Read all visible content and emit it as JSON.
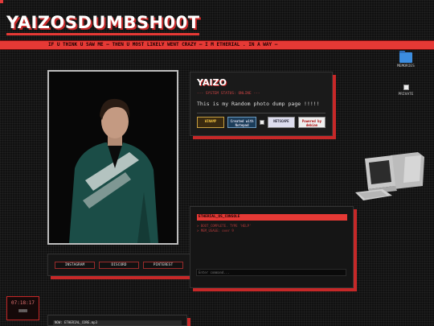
{
  "site": {
    "title": "YAIZOSDUMBSH00T",
    "marquee": "IF U THINK U SAW ME — THEN U MOST LIKELY WENT CRAZY — I M ETHERIAL . IN A WAY —"
  },
  "desktop": {
    "memories_label": "MEMORIES",
    "private_label": "PRIVATE"
  },
  "social": {
    "instagram": "INSTAGRAM",
    "discord": "DISCORD",
    "pinterest": "PINTEREST"
  },
  "card": {
    "title": "YAIZO",
    "status": "--- SYSTEM STATUS: ONLINE ---",
    "text": "This is my Random photo dump page !!!!!",
    "badges": {
      "winamp": "WINAMP",
      "notepad": "Created with Notepad",
      "netscape": "NETSCAPE",
      "debian": "Powered by debian"
    }
  },
  "console": {
    "header": "ETHERIAL_OS_CONSOLE",
    "line1": "> BOOT_COMPLETE. TYPE 'HELP'",
    "line2": "> MEM_USAGE: over 9",
    "placeholder": "Enter command..."
  },
  "clock": {
    "time": "07:18:17"
  },
  "player": {
    "track": "NOW: ETHERIAL_CORE.mp3"
  },
  "colors": {
    "accent": "#e53935",
    "background": "#111111"
  }
}
